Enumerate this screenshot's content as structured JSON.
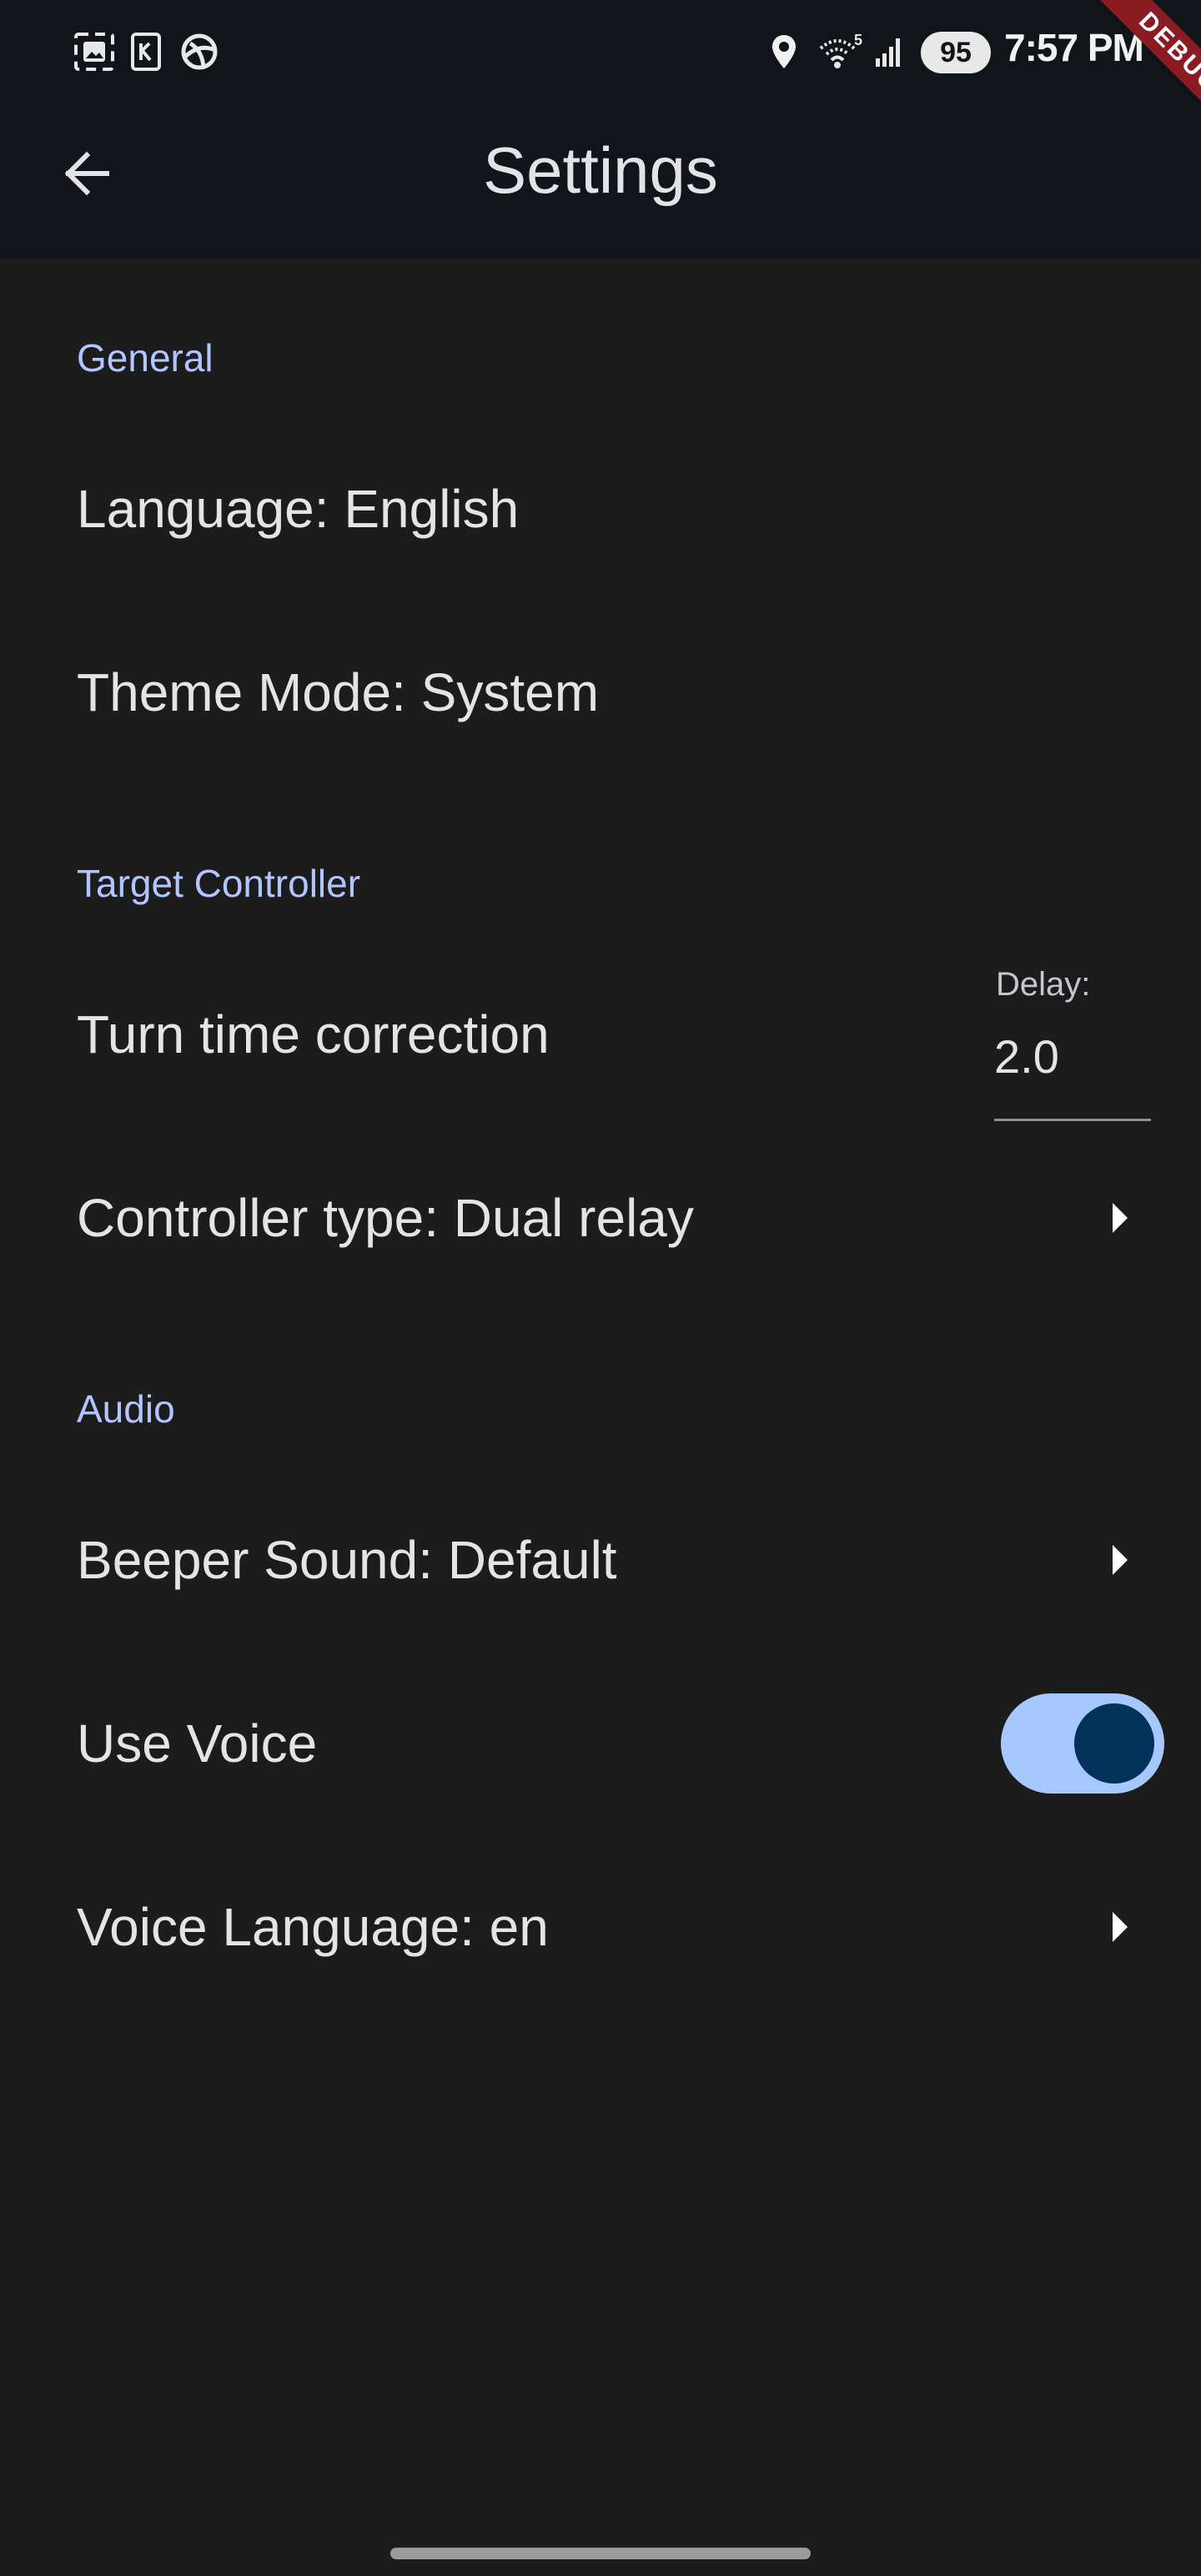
{
  "status_bar": {
    "time": "7:57",
    "time_suffix": "PM",
    "battery_level": "95",
    "wifi_badge": "5",
    "left_icons": [
      "gallery-icon",
      "sim-card-icon",
      "browser-icon"
    ],
    "right_icons": [
      "location-icon",
      "wifi-icon",
      "cell-signal-icon"
    ]
  },
  "debug_banner": "DEBUG",
  "app_bar": {
    "title": "Settings",
    "back_icon": "arrow-back-icon"
  },
  "sections": {
    "general": {
      "header": "General",
      "language": "Language: English",
      "theme_mode": "Theme Mode: System"
    },
    "target_controller": {
      "header": "Target Controller",
      "turn_time_correction": "Turn time correction",
      "delay_label": "Delay:",
      "delay_value": "2.0",
      "controller_type": "Controller type: Dual relay"
    },
    "audio": {
      "header": "Audio",
      "beeper_sound": "Beeper Sound: Default",
      "use_voice": "Use Voice",
      "use_voice_enabled": true,
      "voice_language": "Voice Language: en"
    }
  },
  "colors": {
    "background": "#1c1c1d",
    "app_bar": "#111418",
    "section_header": "#b2c5ff",
    "toggle_track": "#a7c7ff",
    "toggle_knob": "#00325a",
    "debug_banner": "#8b1b22"
  }
}
